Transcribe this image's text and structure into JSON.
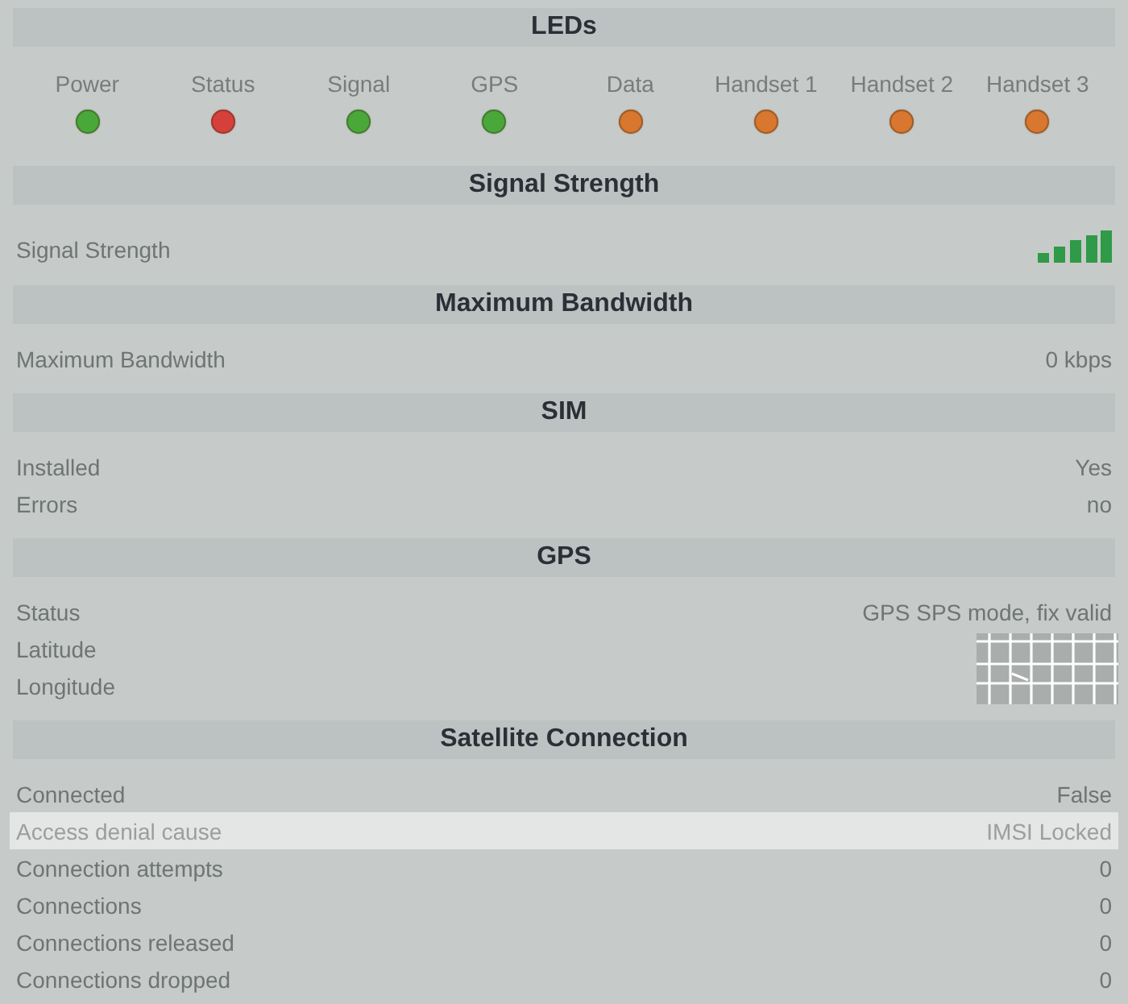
{
  "leds": {
    "title": "LEDs",
    "items": [
      {
        "label": "Power",
        "color": "#4aa83a"
      },
      {
        "label": "Status",
        "color": "#d6403a"
      },
      {
        "label": "Signal",
        "color": "#4aa83a"
      },
      {
        "label": "GPS",
        "color": "#4aa83a"
      },
      {
        "label": "Data",
        "color": "#d8772f"
      },
      {
        "label": "Handset 1",
        "color": "#d8772f"
      },
      {
        "label": "Handset 2",
        "color": "#d8772f"
      },
      {
        "label": "Handset 3",
        "color": "#d8772f"
      }
    ]
  },
  "sections": [
    {
      "title": "Signal Strength",
      "rows": [
        {
          "kind": "signal",
          "label": "Signal Strength",
          "highlighted": false
        }
      ]
    },
    {
      "title": "Maximum Bandwidth",
      "rows": [
        {
          "kind": "text",
          "label": "Maximum Bandwidth",
          "value": "0 kbps",
          "highlighted": false
        }
      ]
    },
    {
      "title": "SIM",
      "rows": [
        {
          "kind": "text",
          "label": "Installed",
          "value": "Yes",
          "highlighted": false
        },
        {
          "kind": "text",
          "label": "Errors",
          "value": "no",
          "highlighted": false
        }
      ]
    },
    {
      "title": "GPS",
      "rows": [
        {
          "kind": "text",
          "label": "Status",
          "value": "GPS SPS mode, fix valid",
          "highlighted": false
        },
        {
          "kind": "covered",
          "label": "Latitude",
          "highlighted": false
        },
        {
          "kind": "covered",
          "label": "Longitude",
          "highlighted": false
        }
      ]
    },
    {
      "title": "Satellite Connection",
      "rows": [
        {
          "kind": "text",
          "label": "Connected",
          "value": "False",
          "highlighted": false
        },
        {
          "kind": "text",
          "label": "Access denial cause",
          "value": "IMSI Locked",
          "highlighted": true
        },
        {
          "kind": "text",
          "label": "Connection attempts",
          "value": "0",
          "highlighted": false
        },
        {
          "kind": "text",
          "label": "Connections",
          "value": "0",
          "highlighted": false
        },
        {
          "kind": "text",
          "label": "Connections released",
          "value": "0",
          "highlighted": false
        },
        {
          "kind": "text",
          "label": "Connections dropped",
          "value": "0",
          "highlighted": false
        }
      ]
    }
  ]
}
